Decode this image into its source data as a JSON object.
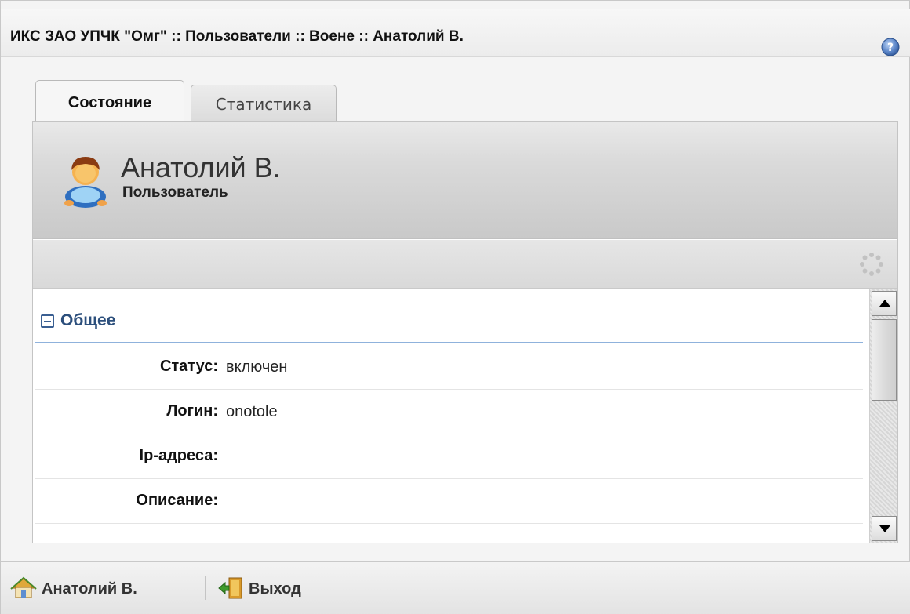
{
  "window": {
    "title": "ИКС ЗАО УПЧК \"Омг\" :: Пользователи :: Воене :: Анатолий В.",
    "help_icon": "help-icon"
  },
  "tabs": [
    {
      "label": "Состояние",
      "active": true
    },
    {
      "label": "Статистика",
      "active": false
    }
  ],
  "user": {
    "name": "Анатолий В.",
    "role": "Пользователь",
    "avatar_icon": "user-avatar-icon"
  },
  "toolbar": {
    "spinner_icon": "loading-spinner-icon"
  },
  "group": {
    "label": "Общее",
    "icon": "collapse-icon",
    "fields": [
      {
        "label": "Статус:",
        "value": "включен"
      },
      {
        "label": "Логин:",
        "value": "onotole"
      },
      {
        "label": "Ip-адреса:",
        "value": ""
      },
      {
        "label": "Описание:",
        "value": ""
      }
    ]
  },
  "footer": {
    "user_label": "Анатолий В.",
    "user_icon": "home-icon",
    "exit_label": "Выход",
    "exit_icon": "exit-door-icon"
  },
  "colors": {
    "accent": "#2c4f7c",
    "group_underline": "#8fb2dc"
  }
}
